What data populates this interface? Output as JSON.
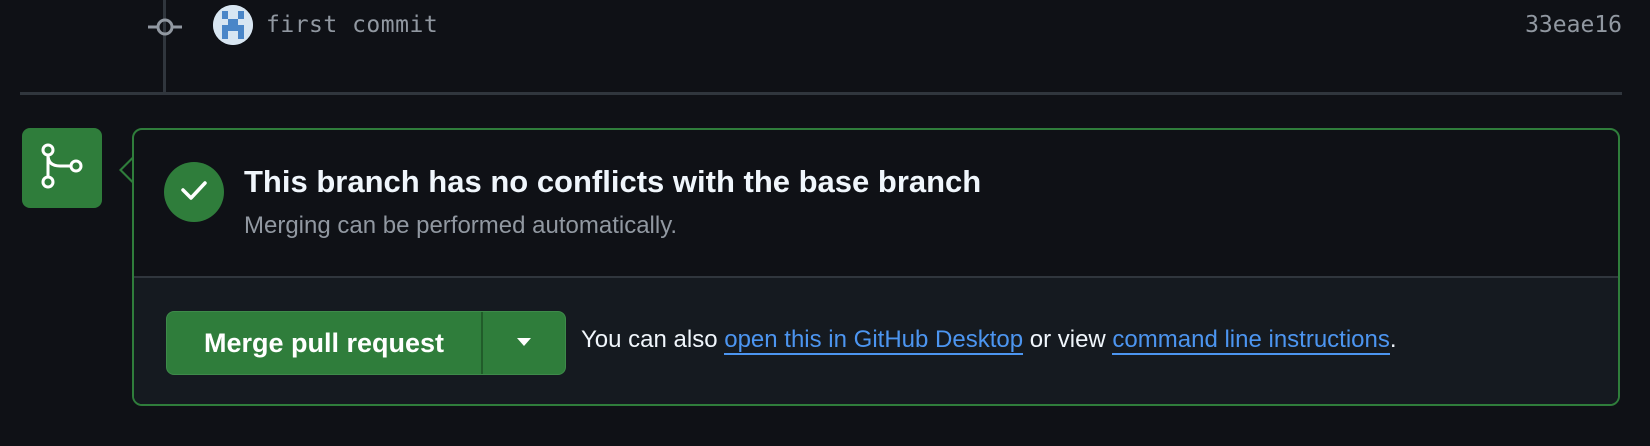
{
  "commit": {
    "message": "first commit",
    "sha": "33eae16"
  },
  "merge_status": {
    "title": "This branch has no conflicts with the base branch",
    "subtitle": "Merging can be performed automatically."
  },
  "actions": {
    "merge_button_label": "Merge pull request",
    "help_prefix": "You can also ",
    "desktop_link": "open this in GitHub Desktop",
    "help_middle": " or view ",
    "cli_link": "command line instructions",
    "help_suffix": "."
  },
  "icons": {
    "commit": "git-commit-icon",
    "merge": "git-merge-icon",
    "check": "check-icon",
    "dropdown": "triangle-down-icon"
  },
  "colors": {
    "background": "#0f1116",
    "success": "#2f7d3b",
    "link": "#4c95f0",
    "muted_text": "#9198a1",
    "border": "#30363d"
  }
}
